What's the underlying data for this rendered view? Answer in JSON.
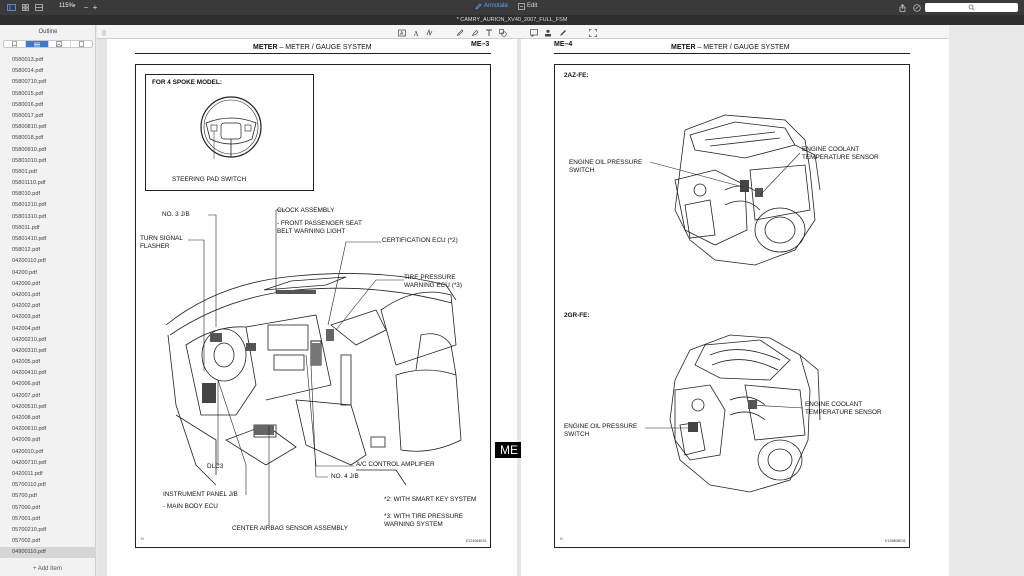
{
  "toolbar": {
    "zoom": "115%",
    "annotate_label": "Annotate",
    "edit_label": "Edit"
  },
  "window": {
    "title": "* CAMRY_AURION_XV40_2007_FULL_FSM"
  },
  "sidebar": {
    "title": "Outline",
    "files": [
      "0580013.pdf",
      "0580014.pdf",
      "05800710.pdf",
      "0580015.pdf",
      "0580016.pdf",
      "0580017.pdf",
      "05800810.pdf",
      "0580018.pdf",
      "05800910.pdf",
      "05801010.pdf",
      "05801.pdf",
      "05801110.pdf",
      "058010.pdf",
      "05801210.pdf",
      "05801310.pdf",
      "058011.pdf",
      "05801410.pdf",
      "058012.pdf",
      "04200110.pdf",
      "04200.pdf",
      "042000.pdf",
      "042001.pdf",
      "042002.pdf",
      "042003.pdf",
      "042004.pdf",
      "04200210.pdf",
      "04200310.pdf",
      "042005.pdf",
      "04200410.pdf",
      "042006.pdf",
      "042007.pdf",
      "04200510.pdf",
      "042008.pdf",
      "04200610.pdf",
      "042009.pdf",
      "0420010.pdf",
      "04200710.pdf",
      "0420011.pdf",
      "05700110.pdf",
      "05700.pdf",
      "057000.pdf",
      "057001.pdf",
      "05700210.pdf",
      "057002.pdf",
      "04900110.pdf"
    ],
    "selected_file": "04900110.pdf",
    "add_item_label": "Add Item"
  },
  "page_left": {
    "header_bold": "METER",
    "header_rest": "–  METER / GAUGE SYSTEM",
    "page_number": "ME–3",
    "inset_title": "FOR 4 SPOKE MODEL:",
    "inset_label": "STEERING PAD SWITCH",
    "labels": {
      "no3_jb": "NO. 3 J/B",
      "clock_assembly": "CLOCK ASSEMBLY",
      "front_passenger": "- FRONT PASSENGER SEAT\nBELT WARNING LIGHT",
      "turn_signal": "TURN SIGNAL\nFLASHER",
      "certification_ecu": "CERTIFICATION ECU (*2)",
      "tire_pressure": "TIRE PRESSURE\nWARNING ECU (*3)",
      "dlc3": "DLC3",
      "ac_control": "A/C CONTROL AMPLIFIER",
      "no4_jb": "NO. 4 J/B",
      "instrument_panel": "INSTRUMENT PANEL J/B",
      "main_body_ecu": "- MAIN BODY ECU",
      "center_airbag": "CENTER AIRBAG SENSOR ASSEMBLY"
    },
    "notes": {
      "note2": "*2: WITH SMART KEY SYSTEM",
      "note3": "*3: WITH TIRE PRESSURE\nWARNING SYSTEM"
    },
    "footer_left": "H",
    "footer_code": "E124064E01"
  },
  "page_right": {
    "page_number": "ME–4",
    "header_bold": "METER",
    "header_rest": "–  METER / GAUGE SYSTEM",
    "engine1_title": "2AZ-FE:",
    "engine1_oil": "ENGINE OIL PRESSURE\nSWITCH",
    "engine1_coolant": "ENGINE COOLANT\nTEMPERATURE SENSOR",
    "engine2_title": "2GR-FE:",
    "engine2_oil": "ENGINE OIL PRESSURE\nSWITCH",
    "engine2_coolant": "ENGINE COOLANT\nTEMPERATURE SENSOR",
    "footer_left": "H",
    "footer_code": "E126808E01"
  },
  "me_tab": {
    "left": "ME",
    "right": "ME"
  }
}
